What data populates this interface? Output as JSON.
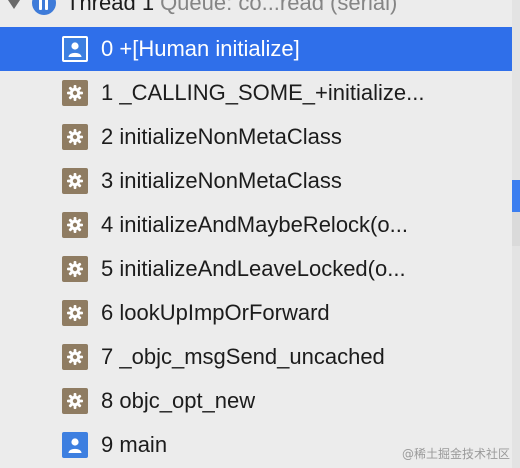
{
  "thread": {
    "name": "Thread 1",
    "queue": "Queue: co...read (serial)"
  },
  "frames": [
    {
      "index": "0",
      "symbol": "+[Human initialize]",
      "icon": "user-icon",
      "selected": true
    },
    {
      "index": "1",
      "symbol": "_CALLING_SOME_+initialize...",
      "icon": "gear-icon",
      "selected": false
    },
    {
      "index": "2",
      "symbol": "initializeNonMetaClass",
      "icon": "gear-icon",
      "selected": false
    },
    {
      "index": "3",
      "symbol": "initializeNonMetaClass",
      "icon": "gear-icon",
      "selected": false
    },
    {
      "index": "4",
      "symbol": "initializeAndMaybeRelock(o...",
      "icon": "gear-icon",
      "selected": false
    },
    {
      "index": "5",
      "symbol": "initializeAndLeaveLocked(o...",
      "icon": "gear-icon",
      "selected": false
    },
    {
      "index": "6",
      "symbol": "lookUpImpOrForward",
      "icon": "gear-icon",
      "selected": false
    },
    {
      "index": "7",
      "symbol": "_objc_msgSend_uncached",
      "icon": "gear-icon",
      "selected": false
    },
    {
      "index": "8",
      "symbol": "objc_opt_new",
      "icon": "gear-icon",
      "selected": false
    },
    {
      "index": "9",
      "symbol": "main",
      "icon": "user-icon",
      "selected": false
    }
  ],
  "watermark": "@稀土掘金技术社区",
  "colors": {
    "selection": "#2f6fea",
    "user_icon": "#3d7fe0",
    "gear_icon": "#8f7c62",
    "thread_icon": "#3e7bd9"
  }
}
